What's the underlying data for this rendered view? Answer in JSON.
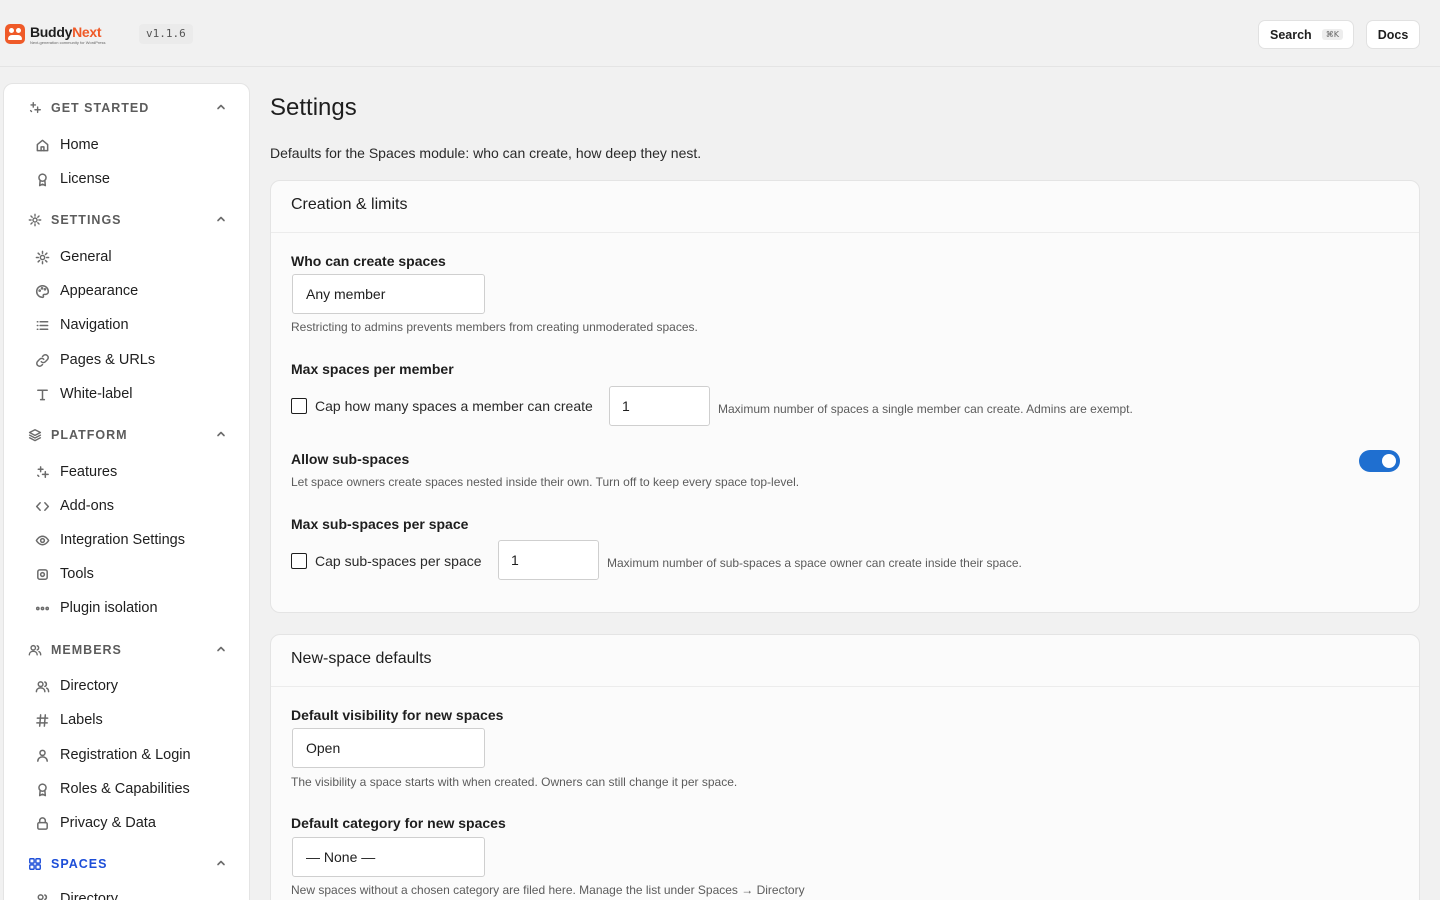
{
  "header": {
    "brand_a": "Buddy",
    "brand_b": "Next",
    "tagline": "Next-generation community for WordPress",
    "version": "v1.1.6",
    "search_label": "Search",
    "search_shortcut": "⌘K",
    "docs_label": "Docs"
  },
  "sidebar": {
    "sections": [
      {
        "label": "GET STARTED",
        "icon": "sparkle-icon",
        "items": [
          {
            "label": "Home",
            "icon": "home-icon"
          },
          {
            "label": "License",
            "icon": "award-icon"
          }
        ]
      },
      {
        "label": "SETTINGS",
        "icon": "gear-icon",
        "items": [
          {
            "label": "General",
            "icon": "gear-icon"
          },
          {
            "label": "Appearance",
            "icon": "palette-icon"
          },
          {
            "label": "Navigation",
            "icon": "list-icon"
          },
          {
            "label": "Pages & URLs",
            "icon": "link-icon"
          },
          {
            "label": "White-label",
            "icon": "type-icon"
          }
        ]
      },
      {
        "label": "PLATFORM",
        "icon": "layers-icon",
        "items": [
          {
            "label": "Features",
            "icon": "sparkle-icon"
          },
          {
            "label": "Add-ons",
            "icon": "code-icon"
          },
          {
            "label": "Integration Settings",
            "icon": "eye-icon"
          },
          {
            "label": "Tools",
            "icon": "tools-icon"
          },
          {
            "label": "Plugin isolation",
            "icon": "dots-icon"
          }
        ]
      },
      {
        "label": "MEMBERS",
        "icon": "users-icon",
        "items": [
          {
            "label": "Directory",
            "icon": "users-icon"
          },
          {
            "label": "Labels",
            "icon": "hash-icon"
          },
          {
            "label": "Registration & Login",
            "icon": "user-icon"
          },
          {
            "label": "Roles & Capabilities",
            "icon": "award-icon"
          },
          {
            "label": "Privacy & Data",
            "icon": "lock-icon"
          }
        ]
      },
      {
        "label": "SPACES",
        "icon": "grid-icon",
        "active": true,
        "accent": "#1d4ed8",
        "items": [
          {
            "label": "Directory",
            "icon": "users-icon"
          }
        ]
      }
    ]
  },
  "main": {
    "title": "Settings",
    "description": "Defaults for the Spaces module: who can create, how deep they nest.",
    "cards": [
      {
        "title": "Creation & limits",
        "who_label": "Who can create spaces",
        "who_value": "Any member",
        "who_help": "Restricting to admins prevents members from creating unmoderated spaces.",
        "max_label": "Max spaces per member",
        "max_check_label": "Cap how many spaces a member can create",
        "max_checked": false,
        "max_value": "1",
        "max_help": "Maximum number of spaces a single member can create. Admins are exempt.",
        "sub_label": "Allow sub-spaces",
        "sub_help": "Let space owners create spaces nested inside their own. Turn off to keep every space top-level.",
        "sub_enabled": true,
        "maxsub_label": "Max sub-spaces per space",
        "maxsub_check_label": "Cap sub-spaces per space",
        "maxsub_checked": false,
        "maxsub_value": "1",
        "maxsub_help": "Maximum number of sub-spaces a space owner can create inside their space."
      },
      {
        "title": "New-space defaults",
        "vis_label": "Default visibility for new spaces",
        "vis_value": "Open",
        "vis_help": "The visibility a space starts with when created. Owners can still change it per space.",
        "cat_label": "Default category for new spaces",
        "cat_value": "— None —",
        "cat_help": "New spaces without a chosen category are filed here. Manage the list under Spaces → Directory"
      }
    ]
  },
  "colors": {
    "brand": "#ef5a28",
    "accent": "#1f6fd0",
    "background": "#f1f1f1"
  }
}
